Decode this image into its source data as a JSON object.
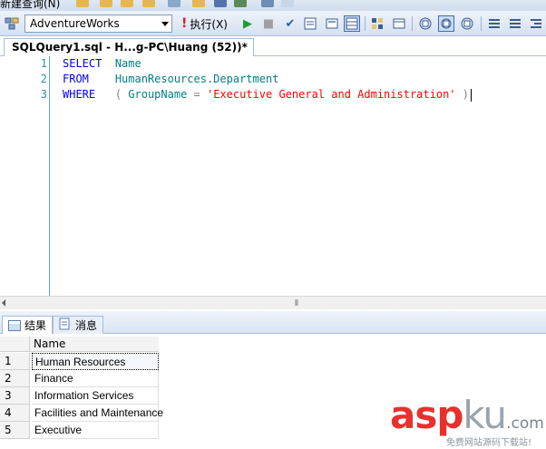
{
  "top_strip": {
    "cut_label": "新建查询(N)"
  },
  "toolbar": {
    "database": "AdventureWorks",
    "execute_label": "执行(X)"
  },
  "document_tab": {
    "title": "SQLQuery1.sql - H...g-PC\\Huang (52))*"
  },
  "editor": {
    "lines": [
      {
        "number": "1",
        "keyword": "SELECT",
        "rest": "Name"
      },
      {
        "number": "2",
        "keyword": "FROM",
        "rest": "HumanResources.Department"
      },
      {
        "number": "3",
        "keyword": "WHERE",
        "open": "( ",
        "column": "GroupName",
        "op": " = ",
        "string": "'Executive General and Administration'",
        "close": " )"
      }
    ]
  },
  "scrollbar": {
    "grip": "⦀"
  },
  "results_tabs": [
    {
      "label": "结果"
    },
    {
      "label": "消息"
    }
  ],
  "grid": {
    "column": "Name",
    "rows": [
      {
        "num": "1",
        "value": "Human Resources"
      },
      {
        "num": "2",
        "value": "Finance"
      },
      {
        "num": "3",
        "value": "Information Services"
      },
      {
        "num": "4",
        "value": "Facilities and Maintenance"
      },
      {
        "num": "5",
        "value": "Executive"
      }
    ]
  },
  "watermark": {
    "asp": "asp",
    "ku": "ku",
    "com": ".com",
    "sub": "免费网站源码下载站!"
  }
}
